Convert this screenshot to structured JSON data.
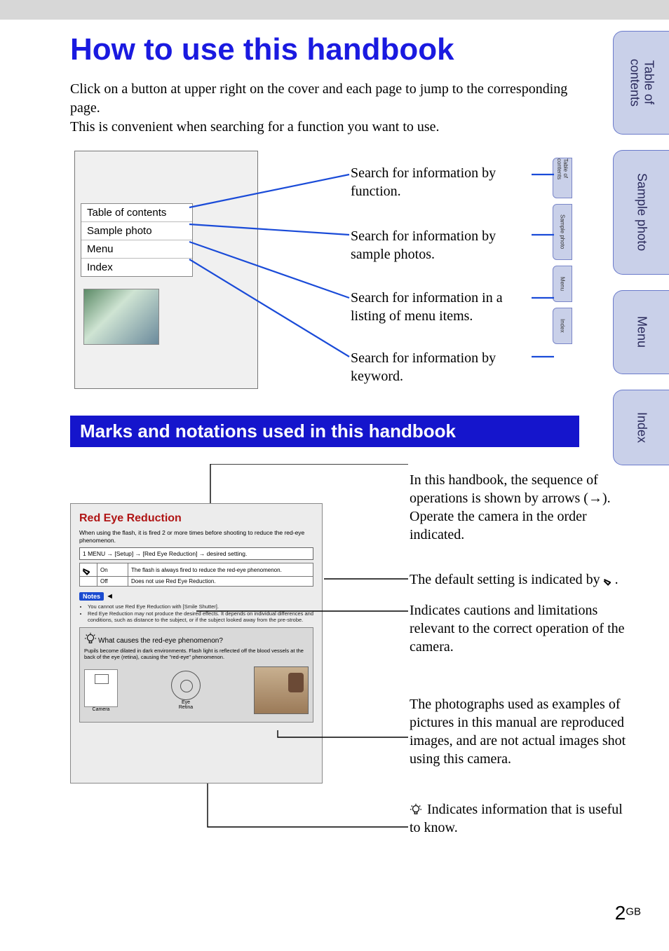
{
  "title": "How to use this handbook",
  "intro_line1": "Click on a button at upper right on the cover and each page to jump to the corresponding page.",
  "intro_line2": "This is convenient when searching for a function you want to use.",
  "sidetabs": {
    "toc": "Table of\ncontents",
    "sample": "Sample photo",
    "menu": "Menu",
    "index": "Index"
  },
  "mock_menu": {
    "toc": "Table of contents",
    "sample": "Sample photo",
    "menu": "Menu",
    "index": "Index"
  },
  "small_tabs": {
    "toc": "Table of contents",
    "sample": "Sample photo",
    "menu": "Menu",
    "index": "Index"
  },
  "diagram_labels": {
    "l1": "Search for information by function.",
    "l2": "Search for information by sample photos.",
    "l3": "Search for information in a listing of menu items.",
    "l4": "Search for information by keyword."
  },
  "section_heading": "Marks and notations used in this handbook",
  "manual_sample": {
    "title": "Red Eye Reduction",
    "desc": "When using the flash, it is fired 2 or more times before shooting to reduce the red-eye phenomenon.",
    "step": "1  MENU → [Setup] → [Red Eye Reduction] → desired setting.",
    "row1a": "On",
    "row1b": "The flash is always fired to reduce the red-eye phenomenon.",
    "row2a": "Off",
    "row2b": "Does not use Red Eye Reduction.",
    "notes_label": "Notes",
    "note1": "You cannot use Red Eye Reduction with [Smile Shutter].",
    "note2": "Red Eye Reduction may not produce the desired effects. It depends on individual differences and conditions, such as distance to the subject, or if the subject looked away from the pre-strobe.",
    "tip_title": "What causes the red-eye phenomenon?",
    "tip_text": "Pupils become dilated in dark environments. Flash light is reflected off the blood vessels at the back of the eye (retina), causing the \"red-eye\" phenomenon.",
    "cap_camera": "Camera",
    "cap_eye": "Eye",
    "cap_retina": "Retina"
  },
  "right_notes": {
    "r1": "In this handbook, the sequence of operations is shown by arrows (→). Operate the camera in the order indicated.",
    "r2_prefix": "The default setting is indicated by ",
    "r2_suffix": ".",
    "r3": "Indicates cautions and limitations relevant to the correct operation of the camera.",
    "r4": "The photographs used as examples of pictures in this manual are reproduced images, and are not actual images shot using this camera.",
    "r5": " Indicates information that is useful to know."
  },
  "page_number": {
    "num": "2",
    "suffix": "GB"
  }
}
